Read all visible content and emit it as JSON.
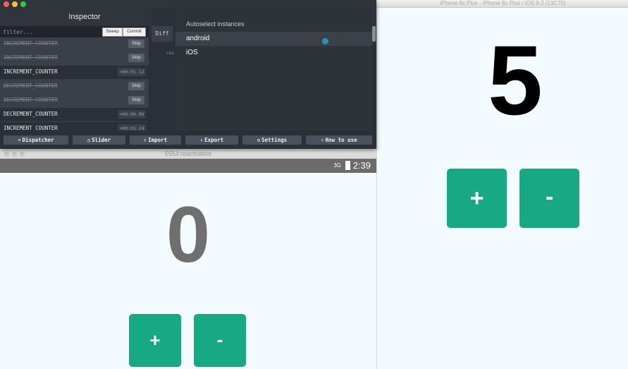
{
  "ios_simulator": {
    "title": "iPhone 6s Plus - iPhone 6s Plus / iOS 9.2 (13C75)",
    "counter_value": "5",
    "increment_label": "+",
    "decrement_label": "-",
    "button_color": "#17a884"
  },
  "android_emulator": {
    "title": "5554:reactnative",
    "status_bar": {
      "network": "3G",
      "time": "2:39"
    },
    "counter_value": "0",
    "increment_label": "+",
    "decrement_label": "-"
  },
  "inspector": {
    "title": "Inspector",
    "filter_placeholder": "filter...",
    "sweep_label": "Sweep",
    "commit_label": "Commit",
    "diff_tab_label": "Diff",
    "diff_truncated_label": "cou",
    "actions": [
      {
        "name": "INCREMENT_COUNTER",
        "tag": "Skip",
        "skipped": true
      },
      {
        "name": "INCREMENT_COUNTER",
        "tag": "Skip",
        "skipped": true
      },
      {
        "name": "INCREMENT_COUNTER",
        "tag": "+00:01.12",
        "skipped": false
      },
      {
        "name": "DECREMENT_COUNTER",
        "tag": "Skip",
        "skipped": true
      },
      {
        "name": "DECREMENT_COUNTER",
        "tag": "Skip",
        "skipped": true
      },
      {
        "name": "DECREMENT_COUNTER",
        "tag": "+00:00.90",
        "skipped": false
      },
      {
        "name": "INCREMENT_COUNTER",
        "tag": "+00:01.24",
        "skipped": false
      }
    ],
    "dropdown": {
      "heading": "Autoselect instances",
      "items": [
        "android",
        "iOS"
      ],
      "highlighted": "android"
    },
    "toolbar": {
      "dispatcher": "Dispatcher",
      "slider": "Slider",
      "import": "Import",
      "export": "Export",
      "settings": "Settings",
      "how_to_use": "How to use"
    }
  },
  "icons": {
    "dispatcher": "keyboard-icon",
    "slider": "stopwatch-icon",
    "import": "upload-icon",
    "export": "download-icon",
    "settings": "gear-icon",
    "how_to_use": "lightbulb-icon"
  }
}
